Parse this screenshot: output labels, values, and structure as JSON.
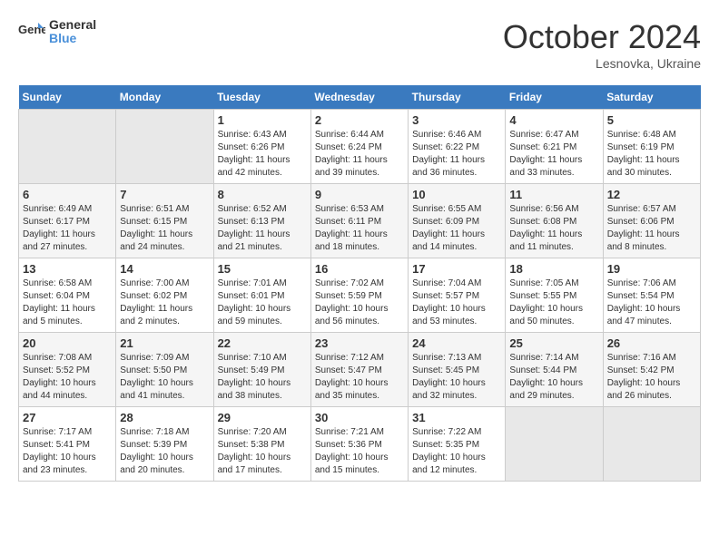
{
  "logo": {
    "text_general": "General",
    "text_blue": "Blue"
  },
  "header": {
    "month": "October 2024",
    "location": "Lesnovka, Ukraine"
  },
  "weekdays": [
    "Sunday",
    "Monday",
    "Tuesday",
    "Wednesday",
    "Thursday",
    "Friday",
    "Saturday"
  ],
  "weeks": [
    [
      {
        "day": "",
        "sunrise": "",
        "sunset": "",
        "daylight": ""
      },
      {
        "day": "",
        "sunrise": "",
        "sunset": "",
        "daylight": ""
      },
      {
        "day": "1",
        "sunrise": "Sunrise: 6:43 AM",
        "sunset": "Sunset: 6:26 PM",
        "daylight": "Daylight: 11 hours and 42 minutes."
      },
      {
        "day": "2",
        "sunrise": "Sunrise: 6:44 AM",
        "sunset": "Sunset: 6:24 PM",
        "daylight": "Daylight: 11 hours and 39 minutes."
      },
      {
        "day": "3",
        "sunrise": "Sunrise: 6:46 AM",
        "sunset": "Sunset: 6:22 PM",
        "daylight": "Daylight: 11 hours and 36 minutes."
      },
      {
        "day": "4",
        "sunrise": "Sunrise: 6:47 AM",
        "sunset": "Sunset: 6:21 PM",
        "daylight": "Daylight: 11 hours and 33 minutes."
      },
      {
        "day": "5",
        "sunrise": "Sunrise: 6:48 AM",
        "sunset": "Sunset: 6:19 PM",
        "daylight": "Daylight: 11 hours and 30 minutes."
      }
    ],
    [
      {
        "day": "6",
        "sunrise": "Sunrise: 6:49 AM",
        "sunset": "Sunset: 6:17 PM",
        "daylight": "Daylight: 11 hours and 27 minutes."
      },
      {
        "day": "7",
        "sunrise": "Sunrise: 6:51 AM",
        "sunset": "Sunset: 6:15 PM",
        "daylight": "Daylight: 11 hours and 24 minutes."
      },
      {
        "day": "8",
        "sunrise": "Sunrise: 6:52 AM",
        "sunset": "Sunset: 6:13 PM",
        "daylight": "Daylight: 11 hours and 21 minutes."
      },
      {
        "day": "9",
        "sunrise": "Sunrise: 6:53 AM",
        "sunset": "Sunset: 6:11 PM",
        "daylight": "Daylight: 11 hours and 18 minutes."
      },
      {
        "day": "10",
        "sunrise": "Sunrise: 6:55 AM",
        "sunset": "Sunset: 6:09 PM",
        "daylight": "Daylight: 11 hours and 14 minutes."
      },
      {
        "day": "11",
        "sunrise": "Sunrise: 6:56 AM",
        "sunset": "Sunset: 6:08 PM",
        "daylight": "Daylight: 11 hours and 11 minutes."
      },
      {
        "day": "12",
        "sunrise": "Sunrise: 6:57 AM",
        "sunset": "Sunset: 6:06 PM",
        "daylight": "Daylight: 11 hours and 8 minutes."
      }
    ],
    [
      {
        "day": "13",
        "sunrise": "Sunrise: 6:58 AM",
        "sunset": "Sunset: 6:04 PM",
        "daylight": "Daylight: 11 hours and 5 minutes."
      },
      {
        "day": "14",
        "sunrise": "Sunrise: 7:00 AM",
        "sunset": "Sunset: 6:02 PM",
        "daylight": "Daylight: 11 hours and 2 minutes."
      },
      {
        "day": "15",
        "sunrise": "Sunrise: 7:01 AM",
        "sunset": "Sunset: 6:01 PM",
        "daylight": "Daylight: 10 hours and 59 minutes."
      },
      {
        "day": "16",
        "sunrise": "Sunrise: 7:02 AM",
        "sunset": "Sunset: 5:59 PM",
        "daylight": "Daylight: 10 hours and 56 minutes."
      },
      {
        "day": "17",
        "sunrise": "Sunrise: 7:04 AM",
        "sunset": "Sunset: 5:57 PM",
        "daylight": "Daylight: 10 hours and 53 minutes."
      },
      {
        "day": "18",
        "sunrise": "Sunrise: 7:05 AM",
        "sunset": "Sunset: 5:55 PM",
        "daylight": "Daylight: 10 hours and 50 minutes."
      },
      {
        "day": "19",
        "sunrise": "Sunrise: 7:06 AM",
        "sunset": "Sunset: 5:54 PM",
        "daylight": "Daylight: 10 hours and 47 minutes."
      }
    ],
    [
      {
        "day": "20",
        "sunrise": "Sunrise: 7:08 AM",
        "sunset": "Sunset: 5:52 PM",
        "daylight": "Daylight: 10 hours and 44 minutes."
      },
      {
        "day": "21",
        "sunrise": "Sunrise: 7:09 AM",
        "sunset": "Sunset: 5:50 PM",
        "daylight": "Daylight: 10 hours and 41 minutes."
      },
      {
        "day": "22",
        "sunrise": "Sunrise: 7:10 AM",
        "sunset": "Sunset: 5:49 PM",
        "daylight": "Daylight: 10 hours and 38 minutes."
      },
      {
        "day": "23",
        "sunrise": "Sunrise: 7:12 AM",
        "sunset": "Sunset: 5:47 PM",
        "daylight": "Daylight: 10 hours and 35 minutes."
      },
      {
        "day": "24",
        "sunrise": "Sunrise: 7:13 AM",
        "sunset": "Sunset: 5:45 PM",
        "daylight": "Daylight: 10 hours and 32 minutes."
      },
      {
        "day": "25",
        "sunrise": "Sunrise: 7:14 AM",
        "sunset": "Sunset: 5:44 PM",
        "daylight": "Daylight: 10 hours and 29 minutes."
      },
      {
        "day": "26",
        "sunrise": "Sunrise: 7:16 AM",
        "sunset": "Sunset: 5:42 PM",
        "daylight": "Daylight: 10 hours and 26 minutes."
      }
    ],
    [
      {
        "day": "27",
        "sunrise": "Sunrise: 7:17 AM",
        "sunset": "Sunset: 5:41 PM",
        "daylight": "Daylight: 10 hours and 23 minutes."
      },
      {
        "day": "28",
        "sunrise": "Sunrise: 7:18 AM",
        "sunset": "Sunset: 5:39 PM",
        "daylight": "Daylight: 10 hours and 20 minutes."
      },
      {
        "day": "29",
        "sunrise": "Sunrise: 7:20 AM",
        "sunset": "Sunset: 5:38 PM",
        "daylight": "Daylight: 10 hours and 17 minutes."
      },
      {
        "day": "30",
        "sunrise": "Sunrise: 7:21 AM",
        "sunset": "Sunset: 5:36 PM",
        "daylight": "Daylight: 10 hours and 15 minutes."
      },
      {
        "day": "31",
        "sunrise": "Sunrise: 7:22 AM",
        "sunset": "Sunset: 5:35 PM",
        "daylight": "Daylight: 10 hours and 12 minutes."
      },
      {
        "day": "",
        "sunrise": "",
        "sunset": "",
        "daylight": ""
      },
      {
        "day": "",
        "sunrise": "",
        "sunset": "",
        "daylight": ""
      }
    ]
  ]
}
